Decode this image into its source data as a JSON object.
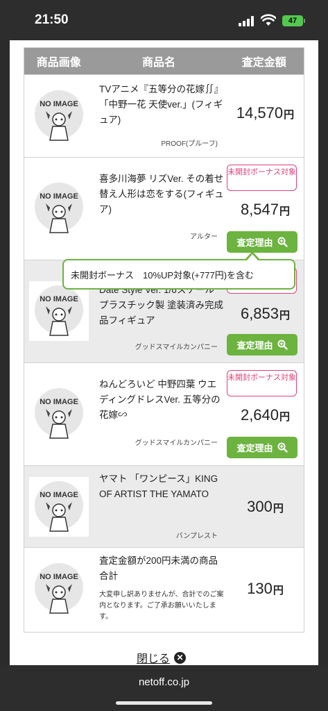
{
  "status_bar": {
    "time": "21:50",
    "battery": "47"
  },
  "table": {
    "headers": {
      "image": "商品画像",
      "name": "商品名",
      "price": "査定金額"
    },
    "no_image_label": "NO IMAGE",
    "yen": "円",
    "reason_label": "査定理由",
    "bonus_label": "未開封ボーナス対象",
    "rows": [
      {
        "name": "TVアニメ『五等分の花嫁∬』「中野一花 天使ver.」(フィギュア)",
        "maker": "PROOF(プルーフ)",
        "price": "14,570"
      },
      {
        "name": "喜多川海夢 リズVer. その着せ替え人形は恋をする(フィギュア)",
        "maker": "アルター",
        "price": "8,547"
      },
      {
        "name": "Date Style Ver. 1/6スケール プラスチック製 塗装済み完成品フィギュア",
        "maker": "グッドスマイルカンパニー",
        "price": "6,853"
      },
      {
        "name": "ねんどろいど 中野四葉 ウエディングドレスVer. 五等分の花嫁∽",
        "maker": "グッドスマイルカンパニー",
        "price": "2,640"
      },
      {
        "name": "ヤマト 「ワンピース」KING OF ARTIST THE YAMATO",
        "maker": "バンプレスト",
        "price": "300"
      },
      {
        "name": "査定金額が200円未満の商品 合計",
        "note": "大変申し訳ありませんが、合計でのご案内となります。ご了承お願いいたします。",
        "price": "130"
      }
    ]
  },
  "tooltip": {
    "text": "未開封ボーナス　10%UP対象(+777円)を含む"
  },
  "close_label": "閉じる",
  "url": "netoff.co.jp",
  "colors": {
    "green": "#6cb33f",
    "pink": "#e0407a",
    "header_grey": "#9a9a9a"
  }
}
